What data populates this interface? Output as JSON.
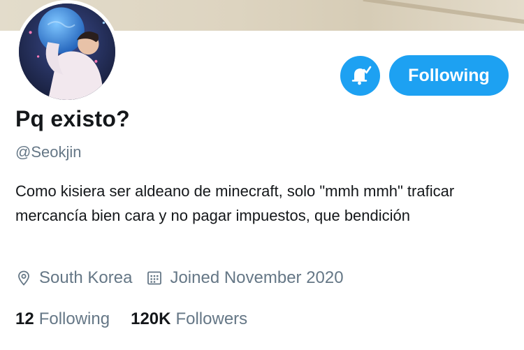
{
  "profile": {
    "display_name": "Pq existo?",
    "handle": "@Seokjin",
    "bio": "Como kisiera ser aldeano de minecraft, solo \"mmh mmh\" traficar mercancía bien cara y no pagar impuestos, que bendición",
    "location": "South Korea",
    "joined": "Joined November 2020"
  },
  "actions": {
    "follow_label": "Following",
    "bell_icon": "bell-check-icon"
  },
  "stats": {
    "following_count": "12",
    "following_label": "Following",
    "followers_count": "120K",
    "followers_label": "Followers"
  },
  "icons": {
    "location": "map-pin-icon",
    "joined": "calendar-icon"
  },
  "colors": {
    "accent": "#1da1f2",
    "text_primary": "#14171a",
    "text_secondary": "#657786"
  }
}
